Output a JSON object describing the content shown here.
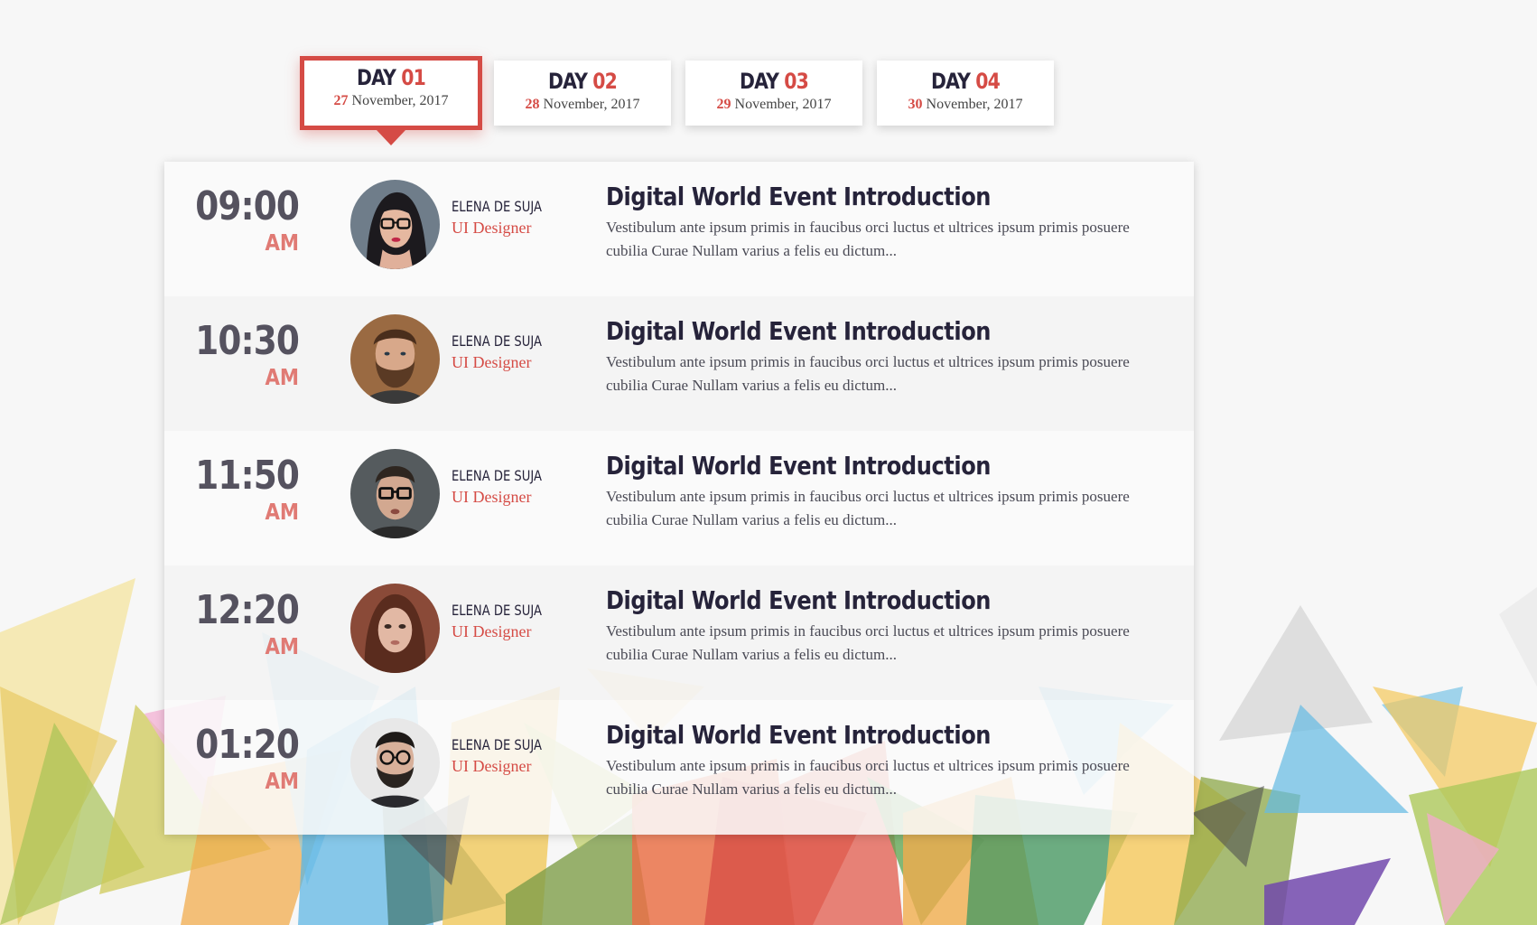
{
  "tabs": [
    {
      "day_word": "DAY",
      "day_num": "01",
      "date_day": "27",
      "date_rest": "November, 2017",
      "active": true
    },
    {
      "day_word": "DAY",
      "day_num": "02",
      "date_day": "28",
      "date_rest": "November, 2017",
      "active": false
    },
    {
      "day_word": "DAY",
      "day_num": "03",
      "date_day": "29",
      "date_rest": "November, 2017",
      "active": false
    },
    {
      "day_word": "DAY",
      "day_num": "04",
      "date_day": "30",
      "date_rest": "November, 2017",
      "active": false
    }
  ],
  "sessions": [
    {
      "time": "09:00",
      "period": "AM",
      "speaker": "ELENA DE SUJA",
      "role": "UI Designer",
      "avatar": "woman-with-glasses-avatar",
      "title": "Digital World Event Introduction",
      "description": "Vestibulum ante ipsum primis in faucibus orci luctus et ultrices ipsum primis posuere cubilia Curae Nullam varius a felis eu dictum..."
    },
    {
      "time": "10:30",
      "period": "AM",
      "speaker": "ELENA DE SUJA",
      "role": "UI Designer",
      "avatar": "bearded-man-avatar",
      "title": "Digital World Event Introduction",
      "description": "Vestibulum ante ipsum primis in faucibus orci luctus et ultrices ipsum primis posuere cubilia Curae Nullam varius a felis eu dictum..."
    },
    {
      "time": "11:50",
      "period": "AM",
      "speaker": "ELENA DE SUJA",
      "role": "UI Designer",
      "avatar": "man-with-glasses-avatar",
      "title": "Digital World Event Introduction",
      "description": "Vestibulum ante ipsum primis in faucibus orci luctus et ultrices ipsum primis posuere cubilia Curae Nullam varius a felis eu dictum..."
    },
    {
      "time": "12:20",
      "period": "AM",
      "speaker": "ELENA DE SUJA",
      "role": "UI Designer",
      "avatar": "woman-portrait-avatar",
      "title": "Digital World Event Introduction",
      "description": "Vestibulum ante ipsum primis in faucibus orci luctus et ultrices ipsum primis posuere cubilia Curae Nullam varius a felis eu dictum..."
    },
    {
      "time": "01:20",
      "period": "AM",
      "speaker": "ELENA DE SUJA",
      "role": "UI Designer",
      "avatar": "man-with-beard-and-glasses-avatar",
      "title": "Digital World Event Introduction",
      "description": "Vestibulum ante ipsum primis in faucibus orci luctus et ultrices ipsum primis posuere cubilia Curae Nullam varius a felis eu dictum..."
    }
  ],
  "colors": {
    "accent": "#d54b45",
    "heading": "#26233a",
    "time": "#55525f",
    "period": "#e07a74"
  }
}
